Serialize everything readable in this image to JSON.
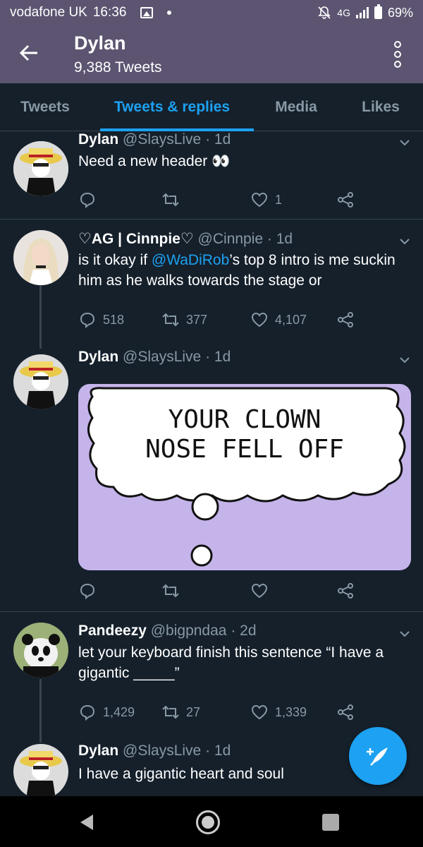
{
  "status_bar": {
    "carrier": "vodafone UK",
    "time": "16:36",
    "network": "4G",
    "battery": "69%"
  },
  "header": {
    "title": "Dylan",
    "subtitle": "9,388 Tweets"
  },
  "tabs": [
    {
      "label": "Tweets",
      "active": false
    },
    {
      "label": "Tweets & replies",
      "active": true
    },
    {
      "label": "Media",
      "active": false
    },
    {
      "label": "Likes",
      "active": false
    }
  ],
  "tweets": [
    {
      "name": "Dylan",
      "handle": "@SlaysLive",
      "time": "· 1d",
      "text_before": "Need a new header",
      "emoji": "👀",
      "replies": "",
      "retweets": "",
      "likes": "1"
    },
    {
      "name": "♡AG | Cinnpie♡",
      "handle": "@Cinnpie",
      "time": "· 1d",
      "text_before": "is it okay if ",
      "mention": "@WaDiRob",
      "text_after": "’s top 8 intro is me suckin him as he walks towards the stage or",
      "replies": "518",
      "retweets": "377",
      "likes": "4,107"
    },
    {
      "name": "Dylan",
      "handle": "@SlaysLive",
      "time": "· 1d",
      "image_text_line1": "YOUR CLOWN",
      "image_text_line2": "NOSE FELL OFF",
      "replies": "",
      "retweets": "",
      "likes": ""
    },
    {
      "name": "Pandeezy",
      "handle": "@bigpndaa",
      "time": "· 2d",
      "text_before": "let your keyboard finish this sentence “I have a gigantic _____”",
      "replies": "1,429",
      "retweets": "27",
      "likes": "1,339"
    },
    {
      "name": "Dylan",
      "handle": "@SlaysLive",
      "time": "· 1d",
      "text_before": "I have a gigantic heart and soul"
    }
  ],
  "colors": {
    "header_bg": "#5c5470",
    "page_bg": "#15202b",
    "accent": "#1da1f2",
    "muted": "#8899a6",
    "meme_bg": "#c5b4ea"
  }
}
